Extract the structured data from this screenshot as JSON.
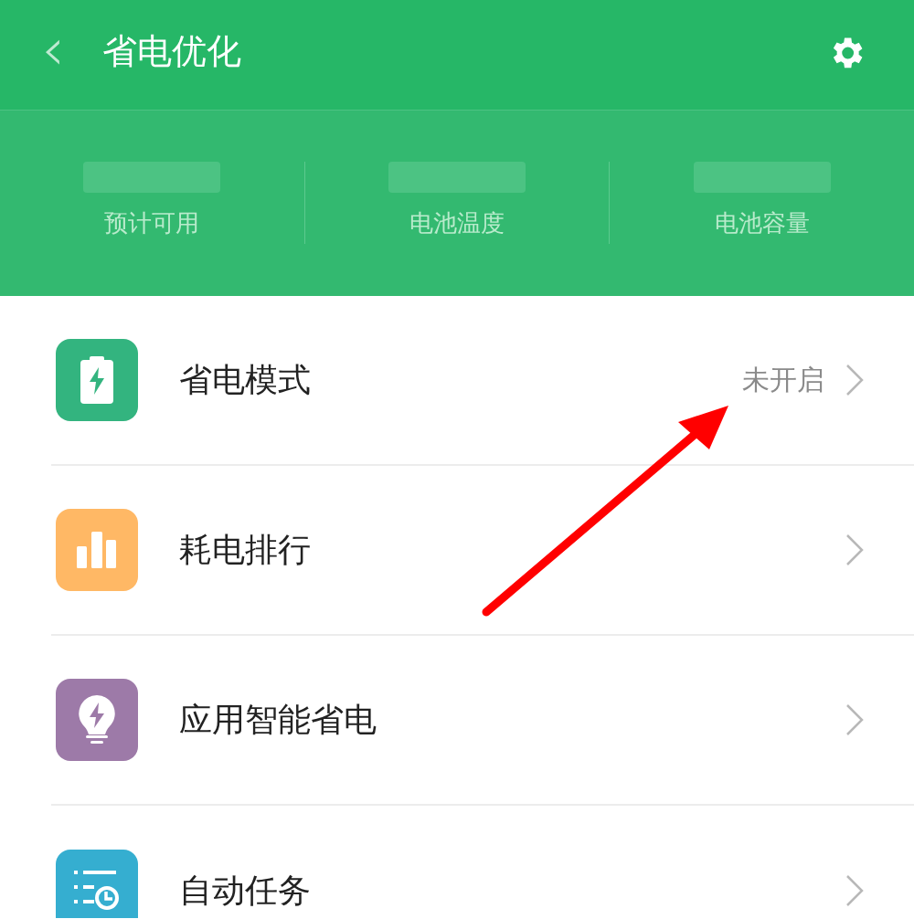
{
  "header": {
    "back": "‹",
    "title": "省电优化"
  },
  "stats": [
    {
      "label": "预计可用"
    },
    {
      "label": "电池温度"
    },
    {
      "label": "电池容量"
    }
  ],
  "items": [
    {
      "kind": "battery",
      "color": "#33b47f",
      "label": "省电模式",
      "status": "未开启"
    },
    {
      "kind": "chart",
      "color": "#ffb865",
      "label": "耗电排行"
    },
    {
      "kind": "bulb",
      "color": "#9d7aa8",
      "label": "应用智能省电"
    },
    {
      "kind": "tasks",
      "color": "#35aed0",
      "label": "自动任务"
    }
  ]
}
